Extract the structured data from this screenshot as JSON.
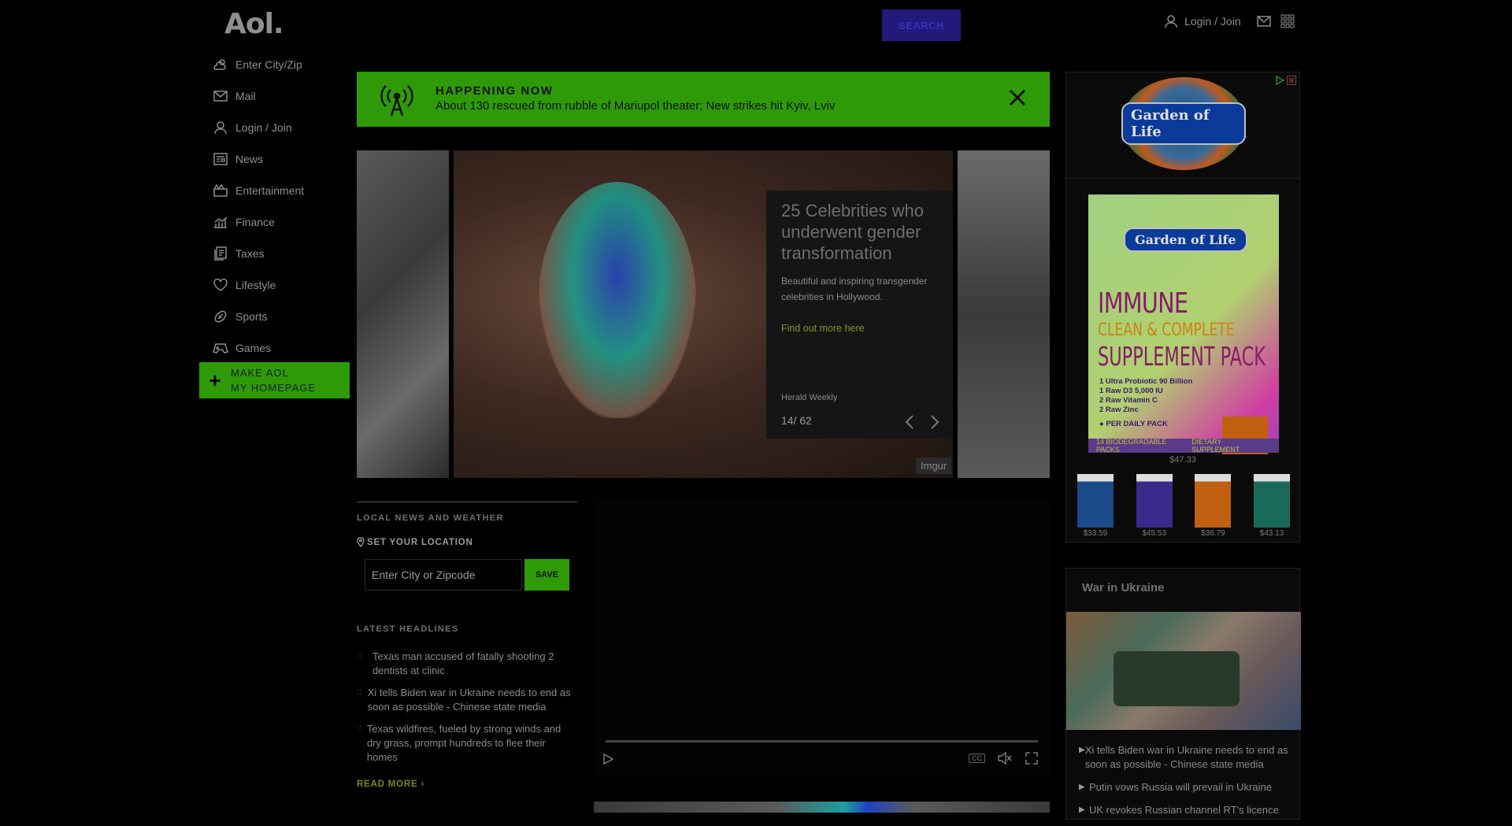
{
  "header": {
    "logo": "Aol.",
    "search_label": "SEARCH",
    "search_placeholder": "",
    "login_label": "Login / Join"
  },
  "nav": {
    "items": [
      {
        "label": "Enter City/Zip",
        "icon": "weather-icon"
      },
      {
        "label": "Mail",
        "icon": "mail-icon"
      },
      {
        "label": "Login / Join",
        "icon": "user-icon"
      },
      {
        "label": "News",
        "icon": "news-icon"
      },
      {
        "label": "Entertainment",
        "icon": "entertainment-icon"
      },
      {
        "label": "Finance",
        "icon": "finance-icon"
      },
      {
        "label": "Taxes",
        "icon": "taxes-icon"
      },
      {
        "label": "Lifestyle",
        "icon": "heart-icon"
      },
      {
        "label": "Sports",
        "icon": "sports-icon"
      },
      {
        "label": "Games",
        "icon": "games-icon"
      }
    ],
    "make_home_line1": "MAKE AOL",
    "make_home_line2": "MY HOMEPAGE"
  },
  "happening": {
    "label": "HAPPENING NOW",
    "headline": "About 130 rescued from rubble of Mariupol theater; New strikes hit Kyiv, Lviv"
  },
  "carousel": {
    "title": "25 Celebrities who underwent gender transformation",
    "description": "Beautiful and inspiring transgender celebrities in Hollywood.",
    "link": "Find out more here",
    "source": "Herald Weekly",
    "counter": "14/ 62",
    "credit": "Imgur"
  },
  "local": {
    "title": "LOCAL NEWS AND WEATHER",
    "set_location": "SET YOUR LOCATION",
    "zip_placeholder": "Enter City or Zipcode",
    "save": "SAVE"
  },
  "latest": {
    "title": "LATEST HEADLINES",
    "items": [
      "Texas man accused of fatally shooting 2 dentists at clinic",
      "Xi tells Biden war in Ukraine needs to end as soon as possible - Chinese state media",
      "Texas wildfires, fueled by strong winds and dry grass, prompt hundreds to flee their homes"
    ],
    "read_more": "READ MORE ›"
  },
  "video": {
    "cc": "CC"
  },
  "ad": {
    "brand": "Garden of Life",
    "line1": "IMMUNE",
    "line2": "CLEAN & COMPLETE",
    "line3": "SUPPLEMENT PACK",
    "details": [
      "1  Ultra Probiotic 90 Billion",
      "1  Raw D3 5,000 IU",
      "2  Raw Vitamin C",
      "2  Raw Zinc"
    ],
    "daily": "● PER DAILY PACK",
    "strip_left": "14 BIODEGRADABLE PACKS",
    "strip_right": "DIETARY SUPPLEMENT",
    "price_main": "$47.33",
    "products": [
      {
        "price": "$33.59",
        "color": "#1a4a8a"
      },
      {
        "price": "$45.53",
        "color": "#3a2a8a"
      },
      {
        "price": "$36.79",
        "color": "#c06010"
      },
      {
        "price": "$43.13",
        "color": "#1a6a5a"
      }
    ]
  },
  "ukraine": {
    "title": "War in Ukraine",
    "items": [
      "Xi tells Biden war in Ukraine needs to end as soon as possible - Chinese state media",
      "Putin vows Russia will prevail in Ukraine",
      "UK revokes Russian channel RT's licence"
    ]
  }
}
